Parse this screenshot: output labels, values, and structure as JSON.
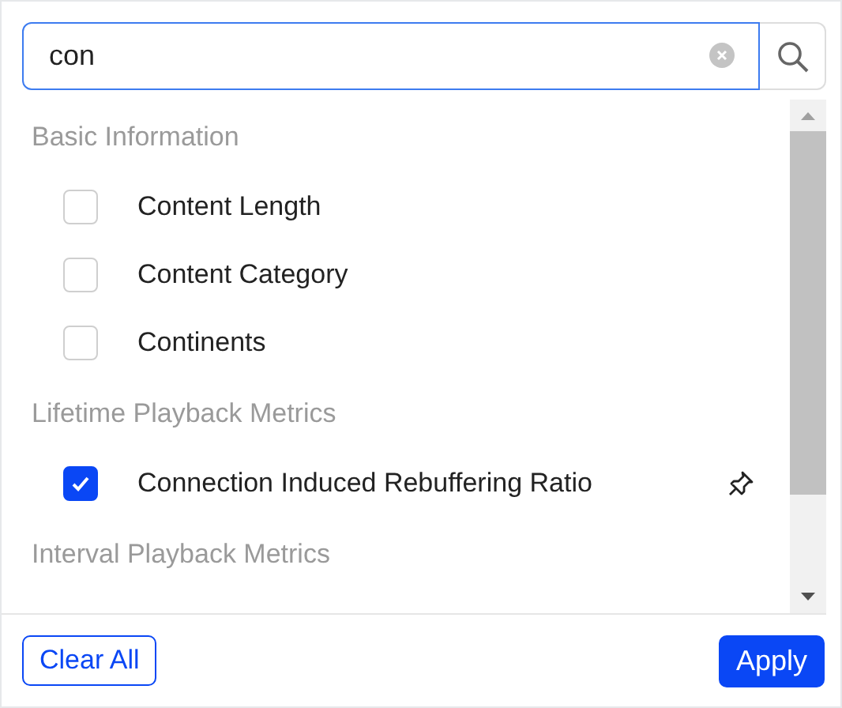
{
  "search": {
    "value": "con"
  },
  "groups": [
    {
      "title": "Basic Information",
      "items": [
        {
          "label": "Content Length",
          "checked": false,
          "pinned": false
        },
        {
          "label": "Content Category",
          "checked": false,
          "pinned": false
        },
        {
          "label": "Continents",
          "checked": false,
          "pinned": false
        }
      ]
    },
    {
      "title": "Lifetime Playback Metrics",
      "items": [
        {
          "label": "Connection Induced Rebuffering Ratio",
          "checked": true,
          "pinned": true
        }
      ]
    },
    {
      "title": "Interval Playback Metrics"
    }
  ],
  "footer": {
    "clear": "Clear All",
    "apply": "Apply"
  }
}
